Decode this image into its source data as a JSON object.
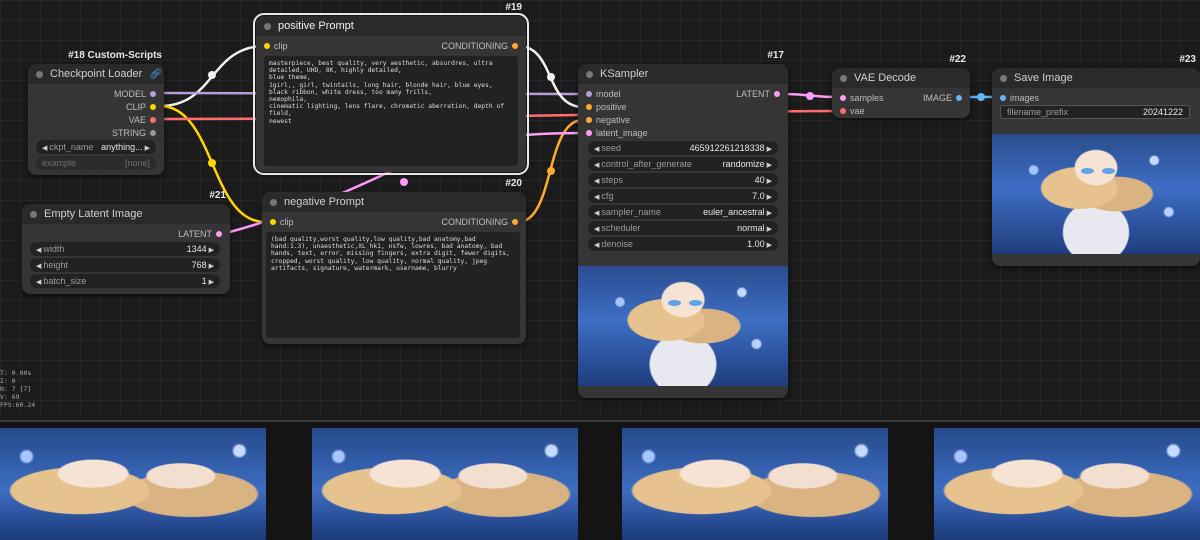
{
  "colors": {
    "model": "#b39ddb",
    "clip": "#ffd500",
    "vae": "#ff6e6e",
    "latent": "#ff9cf9",
    "conditioning": "#ffa931",
    "image": "#64b5f6"
  },
  "positive": {
    "badge": "#19",
    "title": "positive   Prompt",
    "input": "clip",
    "output": "CONDITIONING",
    "text": "masterpiece, best quality, very aesthetic, absurdres, ultra detailed, UHD, 8K, highly detailed,\nblue theme,\n1girl,, girl, twintails, long hair, blonde hair, blue eyes, black ribbon, white dress, too many frills,\nnemophila,\ncinematic lighting, lens flare, chromatic aberration, depth of field,\nnewest"
  },
  "negative": {
    "badge": "#20",
    "title": "negative   Prompt",
    "input": "clip",
    "output": "CONDITIONING",
    "text": "(bad quality,worst quality,low quality,bad anatomy,bad hand:1.3), unaesthetic,XL_hk1, nsfw, lowres, bad anatomy, bad hands, text, error, missing fingers, extra digit, fewer digits, cropped, worst quality, low quality, normal quality, jpeg artifacts, signature, watermark, username, blurry"
  },
  "checkpoint": {
    "badge": "#18 Custom-Scripts",
    "title": "Checkpoint Loader",
    "icon": "link-icon",
    "outputs": [
      "MODEL",
      "CLIP",
      "VAE",
      "STRING"
    ],
    "ckpt_label": "ckpt_name",
    "ckpt_value": "anything...",
    "example_label": "example",
    "example_value": "[none]"
  },
  "latent": {
    "badge": "#21",
    "title": "Empty Latent Image",
    "output": "LATENT",
    "width_label": "width",
    "width_value": "1344",
    "height_label": "height",
    "height_value": "768",
    "batch_label": "batch_size",
    "batch_value": "1"
  },
  "ksampler": {
    "badge": "#17",
    "title": "KSampler",
    "inputs": [
      "model",
      "positive",
      "negative",
      "latent_image"
    ],
    "output": "LATENT",
    "widgets": [
      {
        "label": "seed",
        "value": "465912261218338"
      },
      {
        "label": "control_after_generate",
        "value": "randomize"
      },
      {
        "label": "steps",
        "value": "40"
      },
      {
        "label": "cfg",
        "value": "7.0"
      },
      {
        "label": "sampler_name",
        "value": "euler_ancestral"
      },
      {
        "label": "scheduler",
        "value": "normal"
      },
      {
        "label": "denoise",
        "value": "1.00"
      }
    ]
  },
  "vae_decode": {
    "badge": "#22",
    "title": "VAE Decode",
    "inputs": [
      "samples",
      "vae"
    ],
    "output": "IMAGE"
  },
  "save": {
    "badge": "#23",
    "title": "Save Image",
    "input": "images",
    "prefix_label": "filename_prefix",
    "prefix_value": "20241222"
  },
  "stats": [
    "T: 0.00s",
    "I: 0",
    "N: 7 [7]",
    "V: 69",
    "FPS:60.24"
  ]
}
